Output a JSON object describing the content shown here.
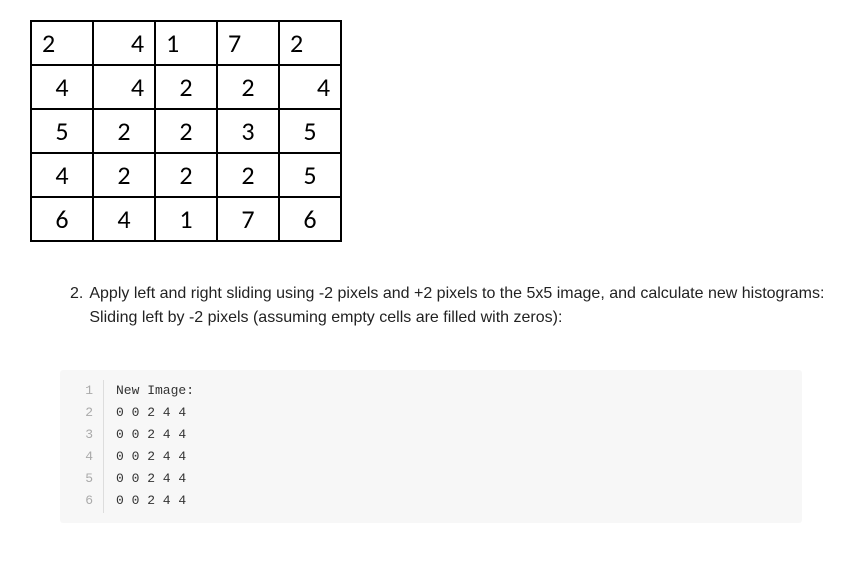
{
  "grid": {
    "rows": [
      [
        "2",
        "4",
        "1",
        "7",
        "2"
      ],
      [
        "4",
        "4",
        "2",
        "2",
        "4"
      ],
      [
        "5",
        "2",
        "2",
        "3",
        "5"
      ],
      [
        "4",
        "2",
        "2",
        "2",
        "5"
      ],
      [
        "6",
        "4",
        "1",
        "7",
        "6"
      ]
    ],
    "align": [
      [
        "l",
        "r",
        "l",
        "l",
        "l"
      ],
      [
        "c",
        "r",
        "c",
        "c",
        "r"
      ],
      [
        "c",
        "c",
        "c",
        "c",
        "c"
      ],
      [
        "c",
        "c",
        "c",
        "c",
        "c"
      ],
      [
        "c",
        "c",
        "c",
        "c",
        "c"
      ]
    ]
  },
  "question": {
    "number": "2.",
    "text": "Apply left and right sliding using -2 pixels and +2 pixels to the 5x5 image, and calculate new histograms: Sliding left by -2 pixels (assuming empty cells are filled with zeros):"
  },
  "code": {
    "lines": [
      "New Image:",
      "0 0 2 4 4",
      "0 0 2 4 4",
      "0 0 2 4 4",
      "0 0 2 4 4",
      "0 0 2 4 4"
    ]
  }
}
